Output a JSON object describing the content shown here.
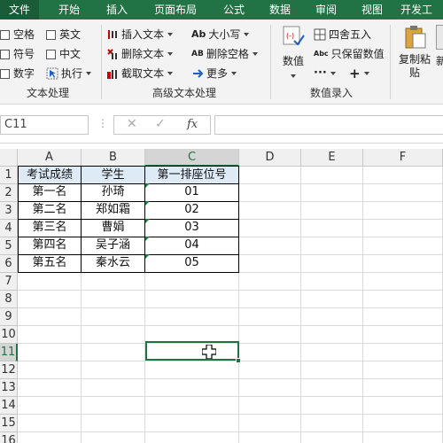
{
  "tabs": {
    "file": "文件",
    "home": "开始",
    "insert": "插入",
    "page_layout": "页面布局",
    "formulas": "公式",
    "data": "数据",
    "review": "审阅",
    "view": "视图",
    "developer": "开发工"
  },
  "ribbon": {
    "text_group": {
      "label": "文本处理",
      "space": "空格",
      "symbol": "符号",
      "number": "数字",
      "english": "英文",
      "chinese": "中文",
      "execute": "执行"
    },
    "advanced_group": {
      "label": "高级文本处理",
      "insert_text": "插入文本",
      "delete_text": "删除文本",
      "extract_text": "截取文本",
      "case": "大小写",
      "delete_spaces": "删除空格",
      "more": "更多",
      "case_icon_text": "Ab",
      "spaces_icon_text": "AB"
    },
    "number_group": {
      "label": "数值录入",
      "value": "数值",
      "round": "四舍五入",
      "keep_value": "只保留数值",
      "keep_icon_text": "Abc"
    },
    "copy_paste": "复制粘贴",
    "new_partial": "新"
  },
  "formula_bar": {
    "name_box": "C11",
    "fx_label": "fx",
    "formula": ""
  },
  "grid": {
    "columns": [
      "A",
      "B",
      "C",
      "D",
      "E",
      "F"
    ],
    "rows": [
      "1",
      "2",
      "3",
      "4",
      "5",
      "6",
      "7",
      "8",
      "9",
      "10",
      "11",
      "12",
      "13",
      "14",
      "15",
      "16"
    ],
    "selected_cell": "C11",
    "table": {
      "headers": [
        "考试成绩",
        "学生",
        "第一排座位号"
      ],
      "rows": [
        [
          "第一名",
          "孙琦",
          "01"
        ],
        [
          "第二名",
          "郑如霜",
          "02"
        ],
        [
          "第三名",
          "曹娟",
          "03"
        ],
        [
          "第四名",
          "吴子涵",
          "04"
        ],
        [
          "第五名",
          "秦水云",
          "05"
        ]
      ]
    }
  },
  "colors": {
    "accent": "#217346",
    "header_fill": "#deebf7",
    "text_indicator": "#1e7a3e"
  }
}
